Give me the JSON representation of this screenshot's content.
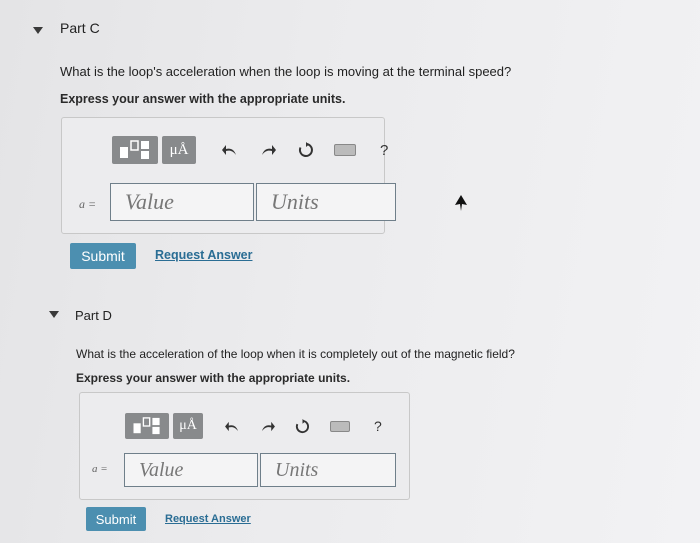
{
  "part_c": {
    "title": "Part C",
    "question": "What is the loop's acceleration when the loop is moving at the terminal speed?",
    "instruction": "Express your answer with the appropriate units.",
    "variable": "a =",
    "value_placeholder": "Value",
    "units_placeholder": "Units",
    "submit_label": "Submit",
    "request_label": "Request Answer"
  },
  "part_d": {
    "title": "Part D",
    "question": "What is the acceleration of the loop when it is completely out of the magnetic field?",
    "instruction": "Express your answer with the appropriate units.",
    "variable": "a =",
    "value_placeholder": "Value",
    "units_placeholder": "Units",
    "submit_label": "Submit",
    "request_label": "Request Answer"
  },
  "toolbar": {
    "units_symbol": "μÅ",
    "help_symbol": "?"
  },
  "colors": {
    "submit_bg": "#4c8fb0",
    "link": "#2a6d94",
    "field_border": "#6f7f8a"
  }
}
